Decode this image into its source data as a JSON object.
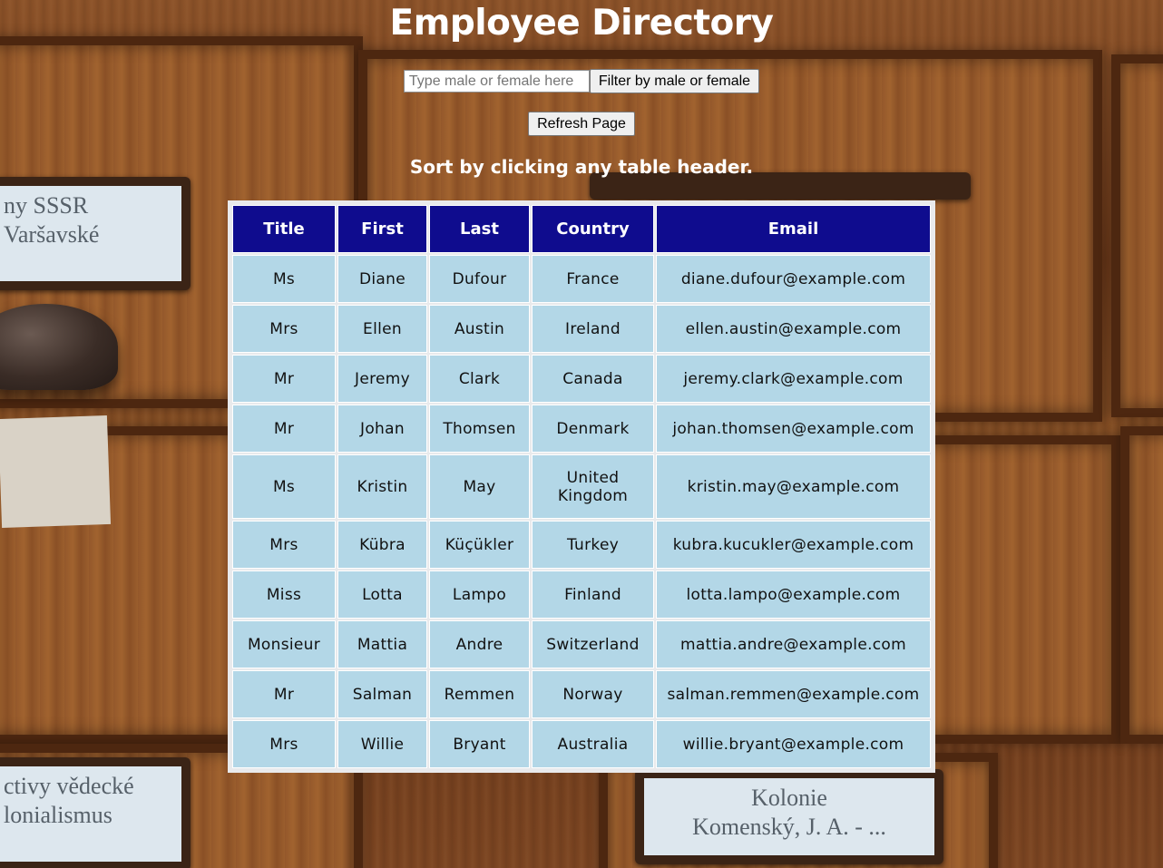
{
  "page": {
    "title": "Employee Directory",
    "sort_hint": "Sort by clicking any table header."
  },
  "filter": {
    "placeholder": "Type male or female here",
    "value": "",
    "button_label": "Filter by male or female"
  },
  "refresh": {
    "button_label": "Refresh Page"
  },
  "background": {
    "labels": [
      [
        "ny SSSR",
        "Varšavské"
      ],
      [
        "ctivy vědecké",
        "lonialismus"
      ],
      [
        "Kolonie",
        "Komenský, J. A. - ..."
      ]
    ]
  },
  "colors": {
    "header_bg": "#0f0c8e",
    "cell_bg": "#b3d7e7",
    "table_frame": "#e9eaec",
    "title_text": "#ffffff"
  },
  "table": {
    "headers": [
      "Title",
      "First",
      "Last",
      "Country",
      "Email"
    ],
    "rows": [
      [
        "Ms",
        "Diane",
        "Dufour",
        "France",
        "diane.dufour@example.com"
      ],
      [
        "Mrs",
        "Ellen",
        "Austin",
        "Ireland",
        "ellen.austin@example.com"
      ],
      [
        "Mr",
        "Jeremy",
        "Clark",
        "Canada",
        "jeremy.clark@example.com"
      ],
      [
        "Mr",
        "Johan",
        "Thomsen",
        "Denmark",
        "johan.thomsen@example.com"
      ],
      [
        "Ms",
        "Kristin",
        "May",
        "United Kingdom",
        "kristin.may@example.com"
      ],
      [
        "Mrs",
        "Kübra",
        "Küçükler",
        "Turkey",
        "kubra.kucukler@example.com"
      ],
      [
        "Miss",
        "Lotta",
        "Lampo",
        "Finland",
        "lotta.lampo@example.com"
      ],
      [
        "Monsieur",
        "Mattia",
        "Andre",
        "Switzerland",
        "mattia.andre@example.com"
      ],
      [
        "Mr",
        "Salman",
        "Remmen",
        "Norway",
        "salman.remmen@example.com"
      ],
      [
        "Mrs",
        "Willie",
        "Bryant",
        "Australia",
        "willie.bryant@example.com"
      ]
    ]
  }
}
